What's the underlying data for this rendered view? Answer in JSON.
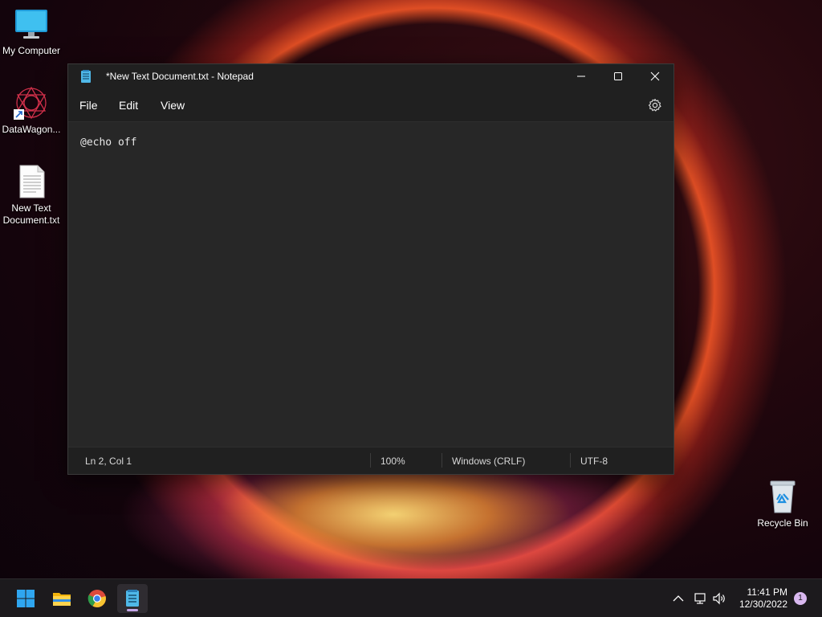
{
  "desktop": {
    "icons": [
      {
        "label": "My Computer",
        "icon": "monitor-icon"
      },
      {
        "label": "DataWagon...",
        "icon": "datawagon-app-icon"
      },
      {
        "label": "New Text Document.txt",
        "icon": "text-file-icon"
      },
      {
        "label": "Recycle Bin",
        "icon": "recycle-bin-icon"
      }
    ]
  },
  "notepad": {
    "title": "*New Text Document.txt - Notepad",
    "menu": {
      "file": "File",
      "edit": "Edit",
      "view": "View"
    },
    "content": "@echo off",
    "status": {
      "position": "Ln 2, Col 1",
      "zoom": "100%",
      "line_ending": "Windows (CRLF)",
      "encoding": "UTF-8"
    }
  },
  "taskbar": {
    "apps": [
      "start-icon",
      "file-explorer-icon",
      "chrome-icon",
      "notepad-icon"
    ],
    "active_app": "notepad-icon",
    "time": "11:41 PM",
    "date": "12/30/2022",
    "notification_count": "1"
  },
  "colors": {
    "window_bg": "#202020",
    "editor_bg": "#272727",
    "taskbar_bg": "#1c1a1d",
    "accent": "#c4a6e8"
  }
}
